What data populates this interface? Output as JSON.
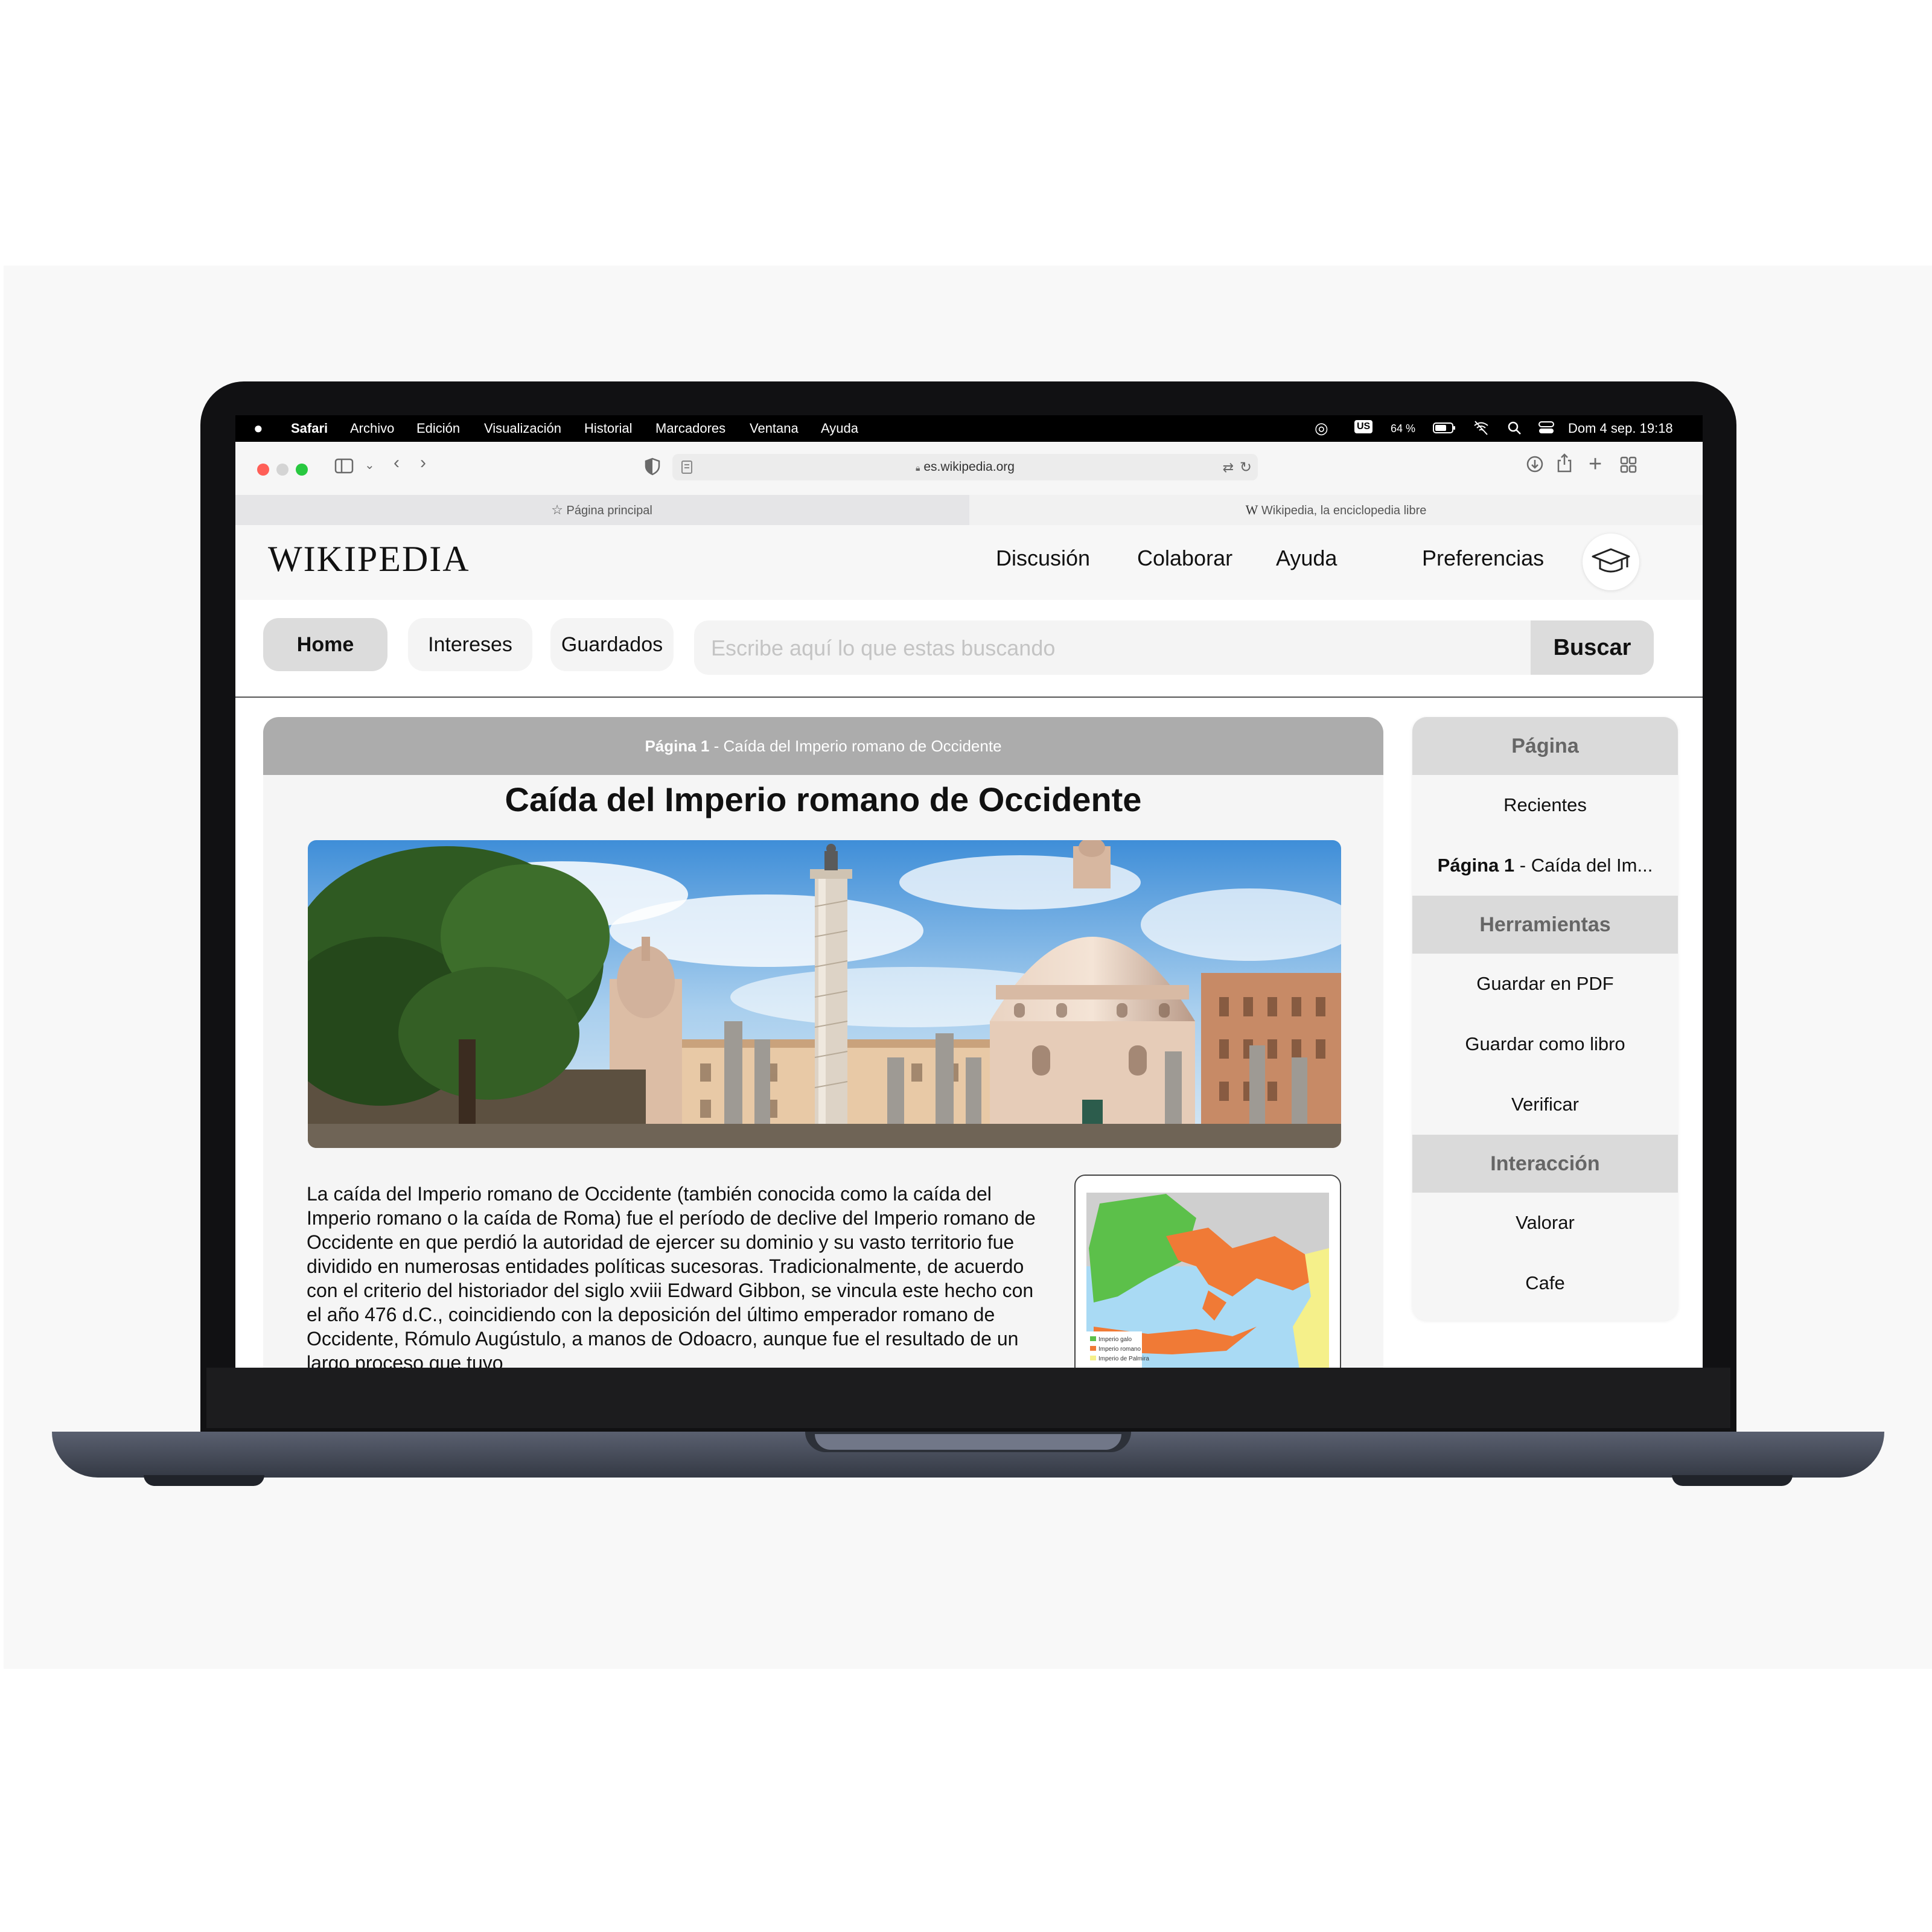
{
  "menubar": {
    "items": [
      "Safari",
      "Archivo",
      "Edición",
      "Visualización",
      "Historial",
      "Marcadores",
      "Ventana",
      "Ayuda"
    ],
    "keyboard": "US",
    "battery": "64 %",
    "datetime": "Dom 4 sep.  19:18"
  },
  "browser": {
    "url": "es.wikipedia.org",
    "tabs": [
      "Página principal",
      "Wikipedia, la enciclopedia libre"
    ],
    "tab_favicon": "W"
  },
  "wiki": {
    "logo": "WIKIPEDIA",
    "nav": [
      "Discusión",
      "Colaborar",
      "Ayuda",
      "Preferencias"
    ],
    "pills": [
      "Home",
      "Intereses",
      "Guardados"
    ],
    "search_placeholder": "Escribe aquí lo que estas buscando",
    "search_button": "Buscar"
  },
  "article": {
    "header_bold": "Página 1",
    "header_rest": " - Caída del Imperio romano de Occidente",
    "title": "Caída del Imperio romano de Occidente",
    "body": "La caída del Imperio romano de Occidente (también conocida como la caída del Imperio romano o la caída de Roma) fue el período de declive del Imperio romano de Occidente en que perdió la autoridad de ejercer su dominio y su vasto territorio fue dividido en numerosas entidades políticas sucesoras. Tradicionalmente, de acuerdo con el criterio del historiador del siglo xviii Edward Gibbon, se vincula este hecho con el año 476 d.C., coincidiendo con la deposición del último emperador romano de Occidente, Rómulo Augústulo, a manos de Odoacro, aunque fue el resultado de un largo proceso que tuvo",
    "map_legend": [
      "Imperio galo",
      "Imperio romano",
      "Imperio de Palmira"
    ]
  },
  "sidebar": {
    "sections": [
      {
        "title": "Página",
        "items": [
          "Recientes"
        ]
      },
      {
        "title": "Herramientas",
        "items": [
          "Guardar en PDF",
          "Guardar como libro",
          "Verificar"
        ]
      },
      {
        "title": "Interacción",
        "items": [
          "Valorar",
          "Cafe"
        ]
      }
    ],
    "page_item_bold": "Página 1",
    "page_item_rest": " - Caída del Im..."
  },
  "colors": {
    "gaul": "#5cc04a",
    "rome": "#f07a36",
    "palmyra": "#f5f08a",
    "sea": "#a9daf4",
    "close": "#ff5f57",
    "zoom": "#28c840"
  }
}
